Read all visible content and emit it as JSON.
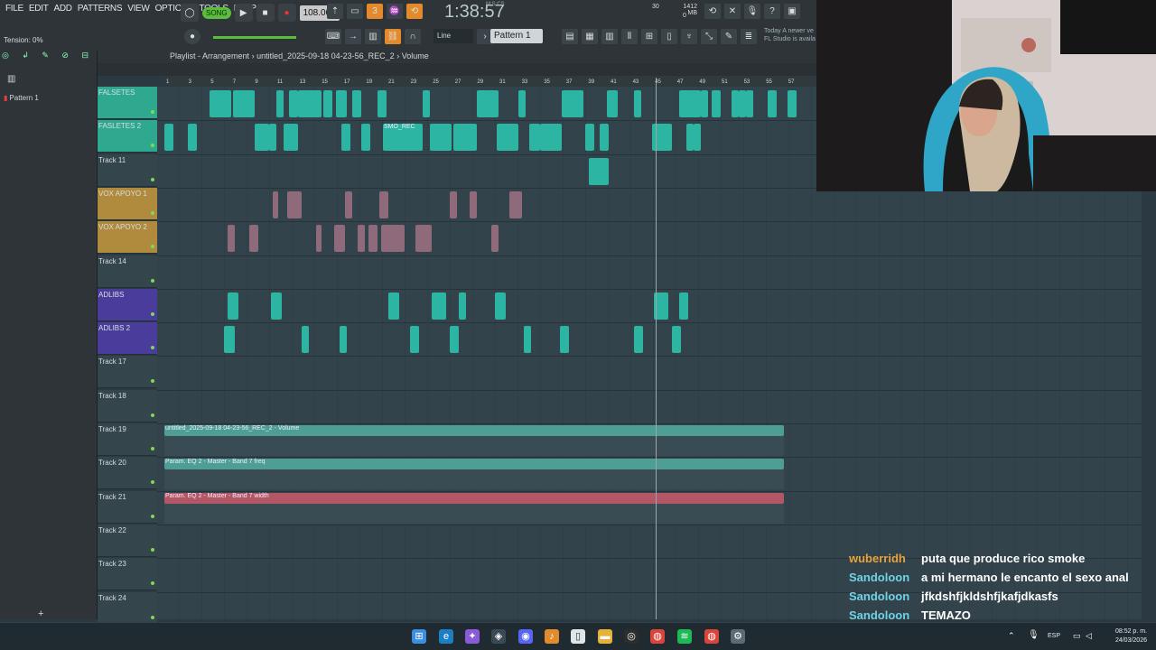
{
  "menu": [
    "FILE",
    "EDIT",
    "ADD",
    "PATTERNS",
    "VIEW",
    "OPTIONS",
    "TOOLS",
    "HELP"
  ],
  "transport": {
    "song_mode": "SONG",
    "tempo": "108.000",
    "time": "1:38:57",
    "time_unit": "M:S:CS",
    "cpu": "30",
    "memory": "1412 MB",
    "mem_sub": "0"
  },
  "news": {
    "line1": "Today  A newer ve",
    "line2": "FL Studio is availa"
  },
  "tension": "Tension: 0%",
  "snap": "Line",
  "pattern": "Pattern 1",
  "browser": {
    "item": "Pattern 1"
  },
  "playlist": {
    "title": "Playlist - Arrangement",
    "sep1": "›",
    "file": "untitled_2025-09-18 04-23-56_REC_2",
    "sep2": "›",
    "target": "Volume"
  },
  "ruler": [
    "1",
    "3",
    "5",
    "7",
    "9",
    "11",
    "13",
    "15",
    "17",
    "19",
    "21",
    "23",
    "25",
    "27",
    "29",
    "31",
    "33",
    "35",
    "37",
    "39",
    "41",
    "43",
    "45",
    "47",
    "49",
    "51",
    "53",
    "55",
    "57"
  ],
  "tracks": [
    {
      "name": "FALSETES",
      "color": "#2fa890"
    },
    {
      "name": "FASLETES 2",
      "color": "#2fa890"
    },
    {
      "name": "Track 11",
      "color": "#34454c"
    },
    {
      "name": "VOX APOYO 1",
      "color": "#b08a3d"
    },
    {
      "name": "VOX APOYO 2",
      "color": "#b08a3d"
    },
    {
      "name": "Track 14",
      "color": "#34454c"
    },
    {
      "name": "ADLIBS",
      "color": "#4a3c9a"
    },
    {
      "name": "ADLIBS 2",
      "color": "#4a3c9a"
    },
    {
      "name": "Track 17",
      "color": "#34454c"
    },
    {
      "name": "Track 18",
      "color": "#34454c"
    },
    {
      "name": "Track 19",
      "color": "#34454c"
    },
    {
      "name": "Track 20",
      "color": "#34454c"
    },
    {
      "name": "Track 21",
      "color": "#34454c"
    },
    {
      "name": "Track 22",
      "color": "#34454c"
    },
    {
      "name": "Track 23",
      "color": "#34454c"
    },
    {
      "name": "Track 24",
      "color": "#34454c"
    }
  ],
  "clip_labels": {
    "un_c": "un_C",
    "smo_rec": "SMO_REC",
    "un_c2": "un_C"
  },
  "automation": {
    "a1": "untitled_2025-09-18 04-23-56_REC_2 - Volume",
    "a2": "Param. EQ 2 - Master - Band 7 freq",
    "a3": "Param. EQ 2 - Master - Band 7 width"
  },
  "chat": [
    {
      "user": "wuberridh",
      "user_color": "#e8a33d",
      "message": "puta que produce rico smoke"
    },
    {
      "user": "Sandoloon",
      "user_color": "#6fd3e6",
      "message": "a mi hermano le encanto el sexo anal"
    },
    {
      "user": "Sandoloon",
      "user_color": "#6fd3e6",
      "message": "jfkdshfjkldshfjkafjdkasfs"
    },
    {
      "user": "Sandoloon",
      "user_color": "#6fd3e6",
      "message": "TEMAZO"
    }
  ],
  "taskbar": {
    "lang": "ESP",
    "time": "08:52 p. m.",
    "date": "24/03/2026"
  }
}
